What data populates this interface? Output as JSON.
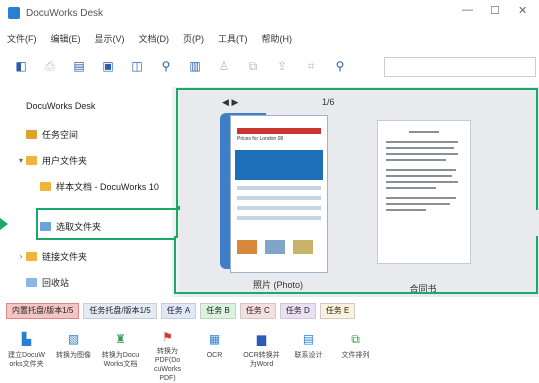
{
  "window": {
    "title": "DocuWorks Desk",
    "minimize": "—",
    "maximize": "☐",
    "close": "✕"
  },
  "menu": [
    "文件(F)",
    "编辑(E)",
    "显示(V)",
    "文档(D)",
    "页(P)",
    "工具(T)",
    "帮助(H)"
  ],
  "toolbar": {
    "page_sep": "·",
    "search_value": ""
  },
  "sidebar": {
    "root": "DocuWorks Desk",
    "items": [
      {
        "label": "任务空间"
      },
      {
        "label": "用户文件夹"
      },
      {
        "label": "样本文档 - DocuWorks 10"
      },
      {
        "label": "选取文件夹"
      },
      {
        "label": "链接文件夹"
      },
      {
        "label": "回收站"
      }
    ]
  },
  "viewer": {
    "nav_left": "◀",
    "nav_right": "▶",
    "page_count": "1/6",
    "doc1_title": "Prices for London 08",
    "doc1_label": "照片 (Photo)",
    "doc2_label": "合同书"
  },
  "tabs": [
    "内置托盘/版本1/5",
    "任务托盘/版本1/5",
    "任务 A",
    "任务 B",
    "任务 C",
    "任务 D",
    "任务 E"
  ],
  "tab_colors": [
    "#f4c5c5",
    "#e3ebf7",
    "#dfe8fb",
    "#daf3dd",
    "#f7dede",
    "#eadff4",
    "#fdf1d9"
  ],
  "dock": [
    {
      "icon": "document-new-icon",
      "label": "建立DocuW\norks文件夹"
    },
    {
      "icon": "image-icon",
      "label": "转换为图像"
    },
    {
      "icon": "docuworks-convert-icon",
      "label": "转换为Docu\nWorks文档"
    },
    {
      "icon": "pdf-icon",
      "label": "转换为 PDF(Do\ncuWorks PDF)"
    },
    {
      "icon": "ocr-icon",
      "label": "OCR"
    },
    {
      "icon": "word-icon",
      "label": "OCR转换并\n为Word"
    },
    {
      "icon": "email-icon",
      "label": "联系设计"
    },
    {
      "icon": "merge-icon",
      "label": "文件排列"
    }
  ]
}
